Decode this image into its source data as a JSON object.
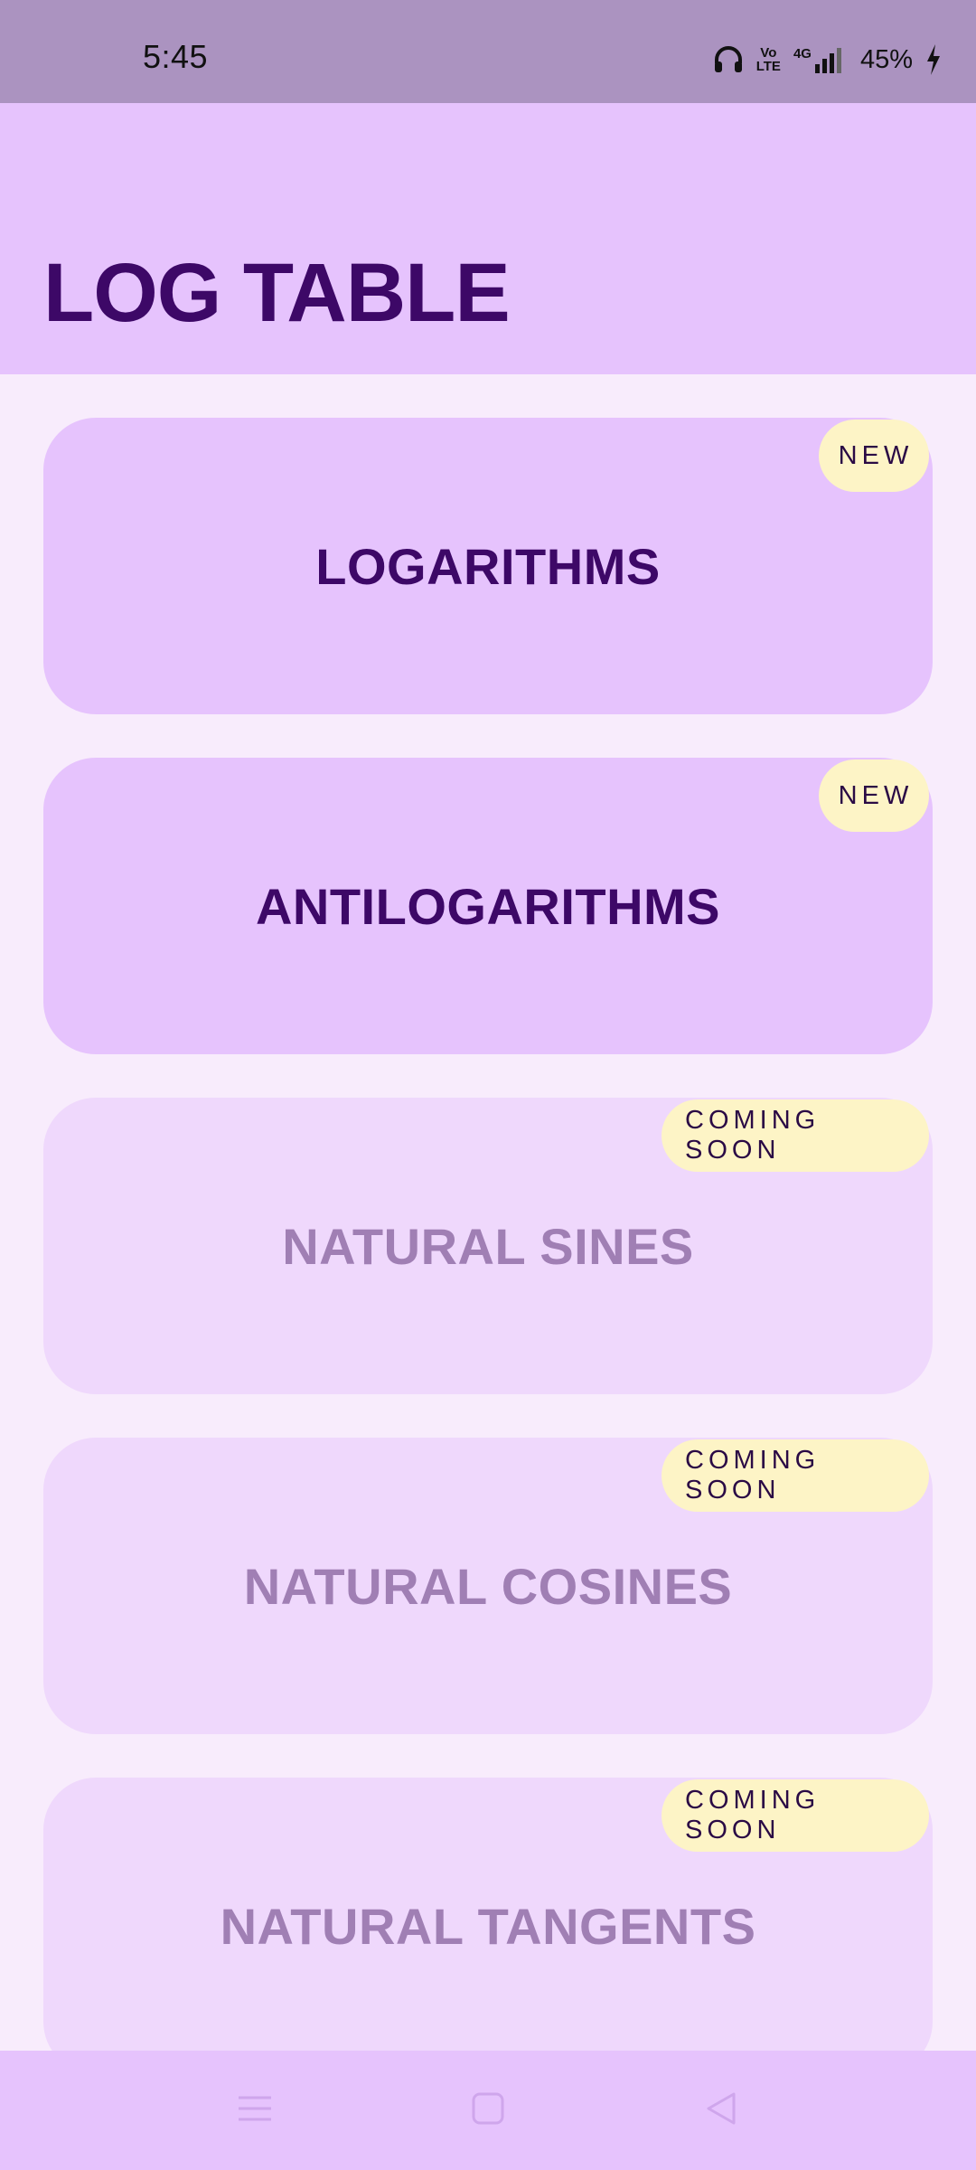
{
  "status_bar": {
    "time": "5:45",
    "network": "4G",
    "volte_line1": "Vo",
    "volte_line2": "LTE",
    "battery": "45%",
    "icons": [
      "headphones-icon",
      "volte-icon",
      "signal-icon",
      "charging-icon"
    ]
  },
  "header": {
    "title": "LOG TABLE"
  },
  "cards": [
    {
      "label": "LOGARITHMS",
      "badge": "NEW",
      "state": "active"
    },
    {
      "label": "ANTILOGARITHMS",
      "badge": "NEW",
      "state": "active"
    },
    {
      "label": "NATURAL SINES",
      "badge": "COMING SOON",
      "state": "disabled"
    },
    {
      "label": "NATURAL COSINES",
      "badge": "COMING SOON",
      "state": "disabled"
    },
    {
      "label": "NATURAL TANGENTS",
      "badge": "COMING SOON",
      "state": "disabled"
    }
  ],
  "nav_bar": {
    "icons": [
      "recent-apps-icon",
      "home-icon",
      "back-icon"
    ]
  },
  "colors": {
    "status_bar": "#ab93c0",
    "header": "#e6c3fd",
    "background": "#f8ecfc",
    "title_text": "#3d0867",
    "disabled_text": "#a07fb4",
    "badge": "#fdf4c6"
  }
}
